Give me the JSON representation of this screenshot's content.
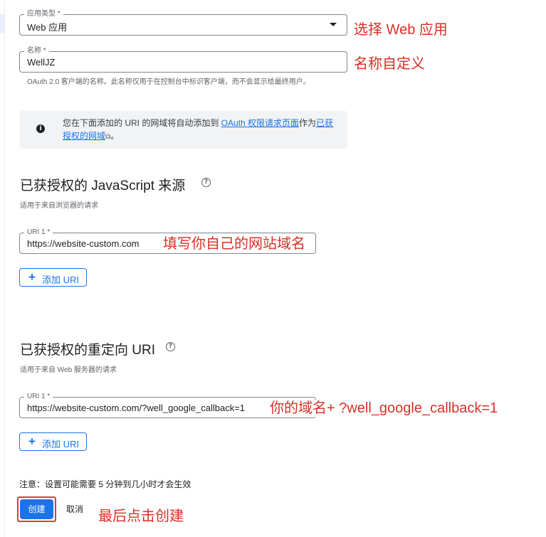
{
  "app_type": {
    "label": "应用类型 *",
    "value": "Web 应用",
    "annotation": "选择 Web 应用"
  },
  "name": {
    "label": "名称 *",
    "value": "WellJZ",
    "annotation": "名称自定义",
    "helper": "OAuth 2.0 客户端的名称。此名称仅用于在控制台中标识客户端，而不会显示给最终用户。"
  },
  "info": {
    "text_before": "您在下面添加的 URI 的网域将自动添加到 ",
    "link1": "OAuth 权限请求页面",
    "text_middle": "作为",
    "link2": "已获授权的网域",
    "text_after": "。"
  },
  "js_origins": {
    "title": "已获授权的 JavaScript 来源",
    "subtitle": "适用于来自浏览器的请求",
    "uri_label": "URI 1 *",
    "uri_value": "https://website-custom.com",
    "annotation": "填写你自己的网站域名",
    "add_button": "添加 URI"
  },
  "redirect_uris": {
    "title": "已获授权的重定向 URI",
    "subtitle": "适用于来自 Web 服务器的请求",
    "uri_label": "URI 1 *",
    "uri_value": "https://website-custom.com/?well_google_callback=1",
    "annotation": "你的域名+ ?well_google_callback=1",
    "add_button": "添加 URI"
  },
  "footer": {
    "note": "注意：设置可能需要 5 分钟到几小时才会生效",
    "create": "创建",
    "cancel": "取消",
    "annotation": "最后点击创建"
  },
  "icons": {
    "info": "info-icon",
    "help": "help-circle-icon",
    "add": "plus-icon",
    "dropdown": "dropdown-arrow-icon",
    "external": "external-link-icon"
  },
  "colors": {
    "primary": "#1a73e8",
    "annotation": "#d93025",
    "highlight_outline": "#e53935",
    "info_bg": "#f1f3f4"
  }
}
